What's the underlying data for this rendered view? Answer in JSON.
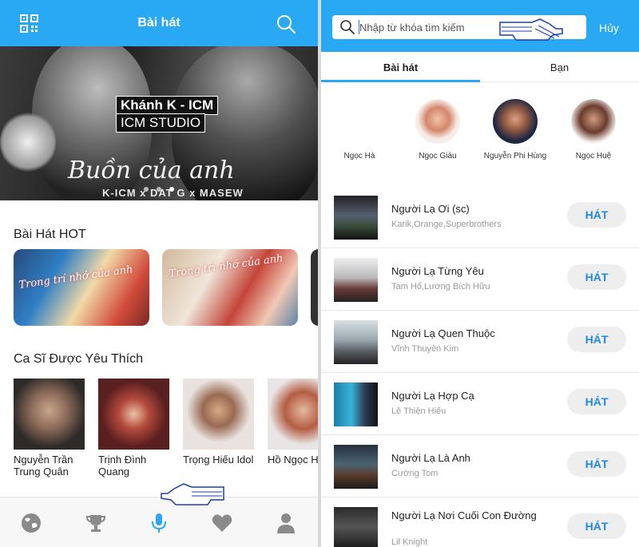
{
  "left": {
    "header": {
      "title": "Bài hát"
    },
    "banner": {
      "tag_line1": "Khánh K - ICM",
      "tag_line2": "ICM STUDIO",
      "script_title": "Buồn của anh",
      "credits": "K-ICM x DAT G x MASEW"
    },
    "hot_section": {
      "title": "Bài Hát HOT",
      "cards": [
        {
          "text": "Trong trí nhớ của anh"
        },
        {
          "text": "Trong trí nhớ của anh"
        }
      ]
    },
    "singers_section": {
      "title": "Ca Sĩ Được Yêu Thích",
      "singers": [
        {
          "name": "Nguyễn Trần Trung Quân"
        },
        {
          "name": "Trịnh Đình Quang"
        },
        {
          "name": "Trọng Hiếu Idol"
        },
        {
          "name": "Hồ Ngọc Hà"
        }
      ]
    },
    "bottom_nav": {
      "items": [
        "world-icon",
        "trophy-icon",
        "microphone-icon",
        "heart-icon",
        "person-icon"
      ],
      "active": "microphone-icon",
      "active_color": "#29a8f3",
      "inactive_color": "#8a8a8a"
    }
  },
  "right": {
    "search": {
      "placeholder": "Nhập từ khóa tìm kiếm",
      "value": "",
      "cancel": "Hủy"
    },
    "tabs": [
      {
        "label": "Bài hát"
      },
      {
        "label": "Bạn"
      }
    ],
    "artists": [
      {
        "name": "Ngọc Hà"
      },
      {
        "name": "Ngọc Giàu"
      },
      {
        "name": "Nguyễn Phi Hùng"
      },
      {
        "name": "Ngọc Huệ"
      }
    ],
    "songs": [
      {
        "title": "Người Lạ Ơi (sc)",
        "artist": "Karik,Orange,Superbrothers",
        "button": "HÁT"
      },
      {
        "title": "Người Lạ Từng Yêu",
        "artist": "Tam Hổ,Lương Bích Hữu",
        "button": "HÁT"
      },
      {
        "title": "Người Lạ Quen Thuộc",
        "artist": "Vĩnh Thuyên Kim",
        "button": "HÁT"
      },
      {
        "title": "Người Lạ Hợp Cạ",
        "artist": "Lê Thiện Hiếu",
        "button": "HÁT"
      },
      {
        "title": "Người Lạ Là Anh",
        "artist": "Cường Tom",
        "button": "HÁT"
      },
      {
        "title": "Người Lạ Nơi Cuối Con Đường",
        "artist": "Lil Knight",
        "button": "HÁT"
      }
    ]
  },
  "colors": {
    "brand": "#29a8f3",
    "button_text": "#1e88e5",
    "button_bg": "#eeeeef"
  }
}
